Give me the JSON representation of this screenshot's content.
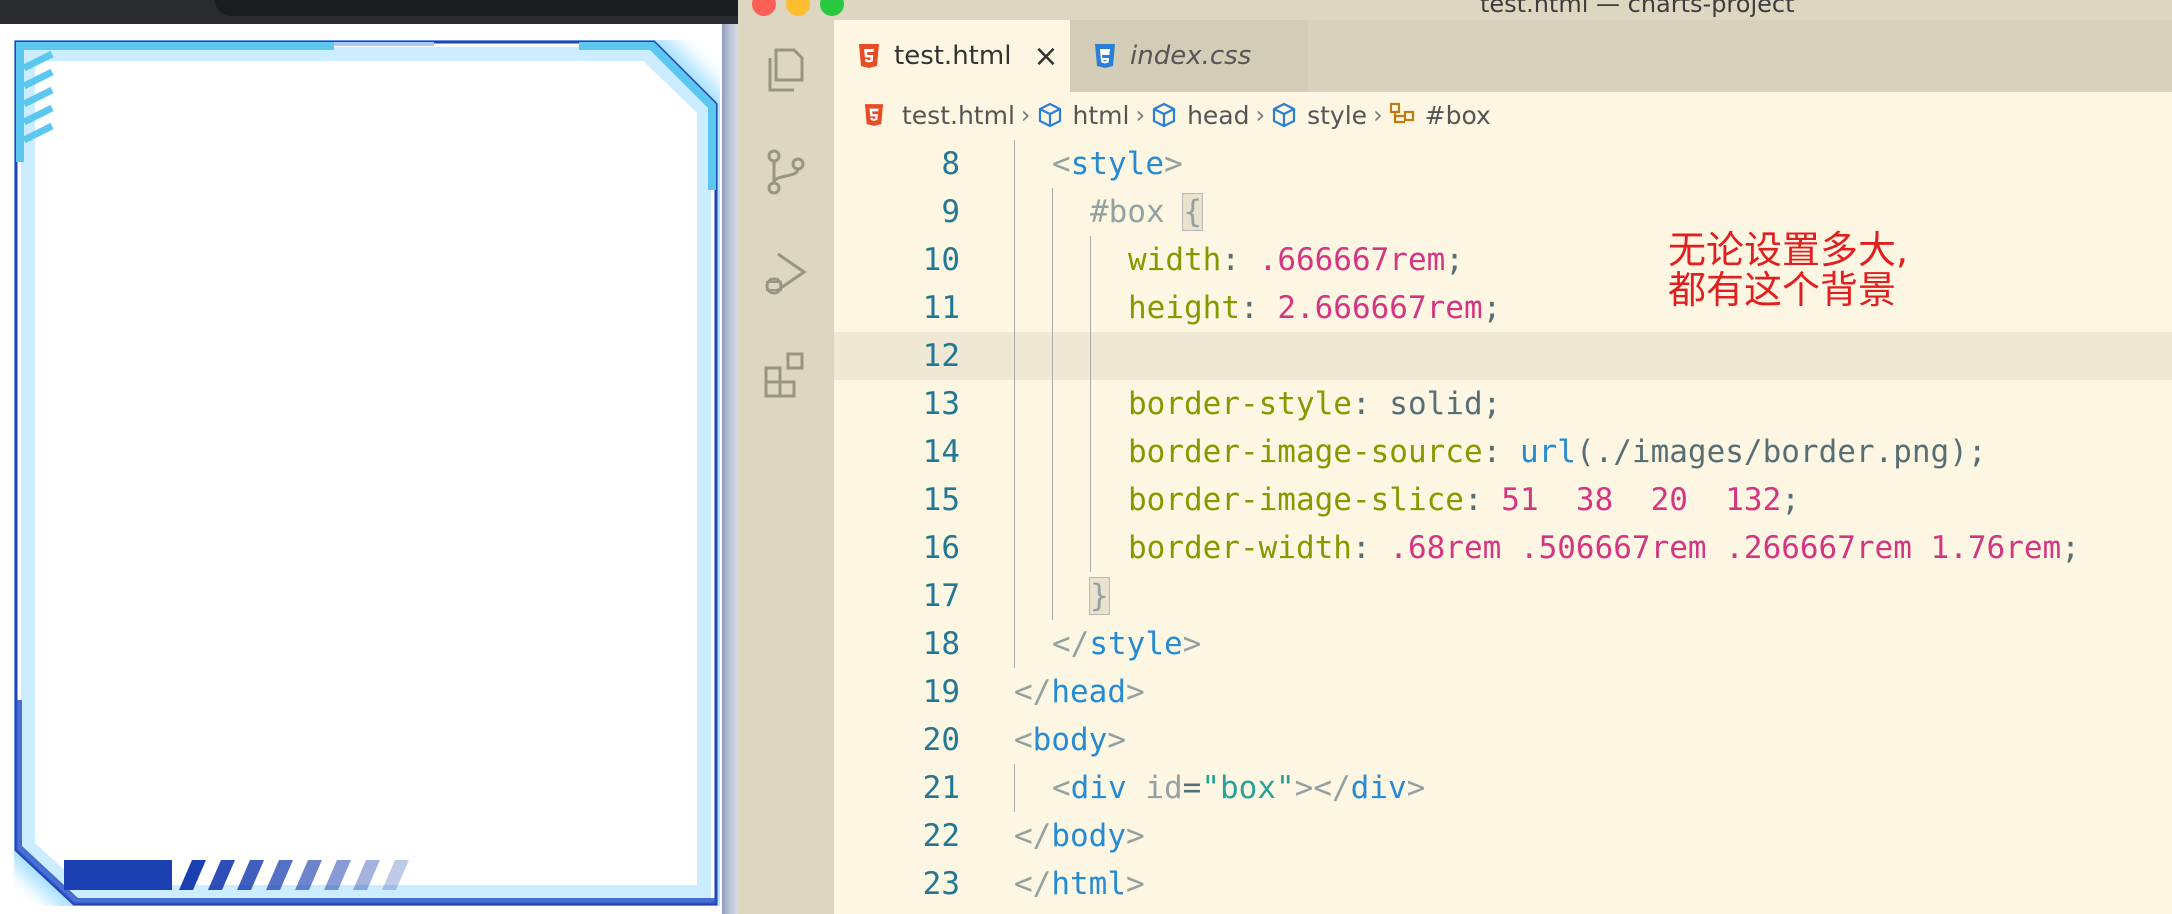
{
  "window": {
    "title": "test.html — charts-project"
  },
  "tabs": [
    {
      "label": "test.html",
      "icon": "html5-icon",
      "active": true,
      "close": "×"
    },
    {
      "label": "index.css",
      "icon": "css3-icon",
      "active": false
    }
  ],
  "breadcrumb": [
    {
      "label": "test.html",
      "icon": "html5-icon"
    },
    {
      "label": "html",
      "icon": "cube-icon"
    },
    {
      "label": "head",
      "icon": "cube-icon"
    },
    {
      "label": "style",
      "icon": "cube-icon"
    },
    {
      "label": "#box",
      "icon": "selector-icon"
    }
  ],
  "code": [
    {
      "n": "8",
      "tokens": [
        [
          "c-punct",
          "<"
        ],
        [
          "c-tag",
          "style"
        ],
        [
          "c-punct",
          ">"
        ]
      ],
      "indent": 1
    },
    {
      "n": "9",
      "tokens": [
        [
          "c-sel",
          "#box "
        ],
        [
          "c-punct brace-box",
          "{"
        ]
      ],
      "indent": 2
    },
    {
      "n": "10",
      "tokens": [
        [
          "c-prop",
          "width"
        ],
        [
          "c-plain",
          ": "
        ],
        [
          "c-num",
          ".666667rem"
        ],
        [
          "c-plain",
          ";"
        ]
      ],
      "indent": 3
    },
    {
      "n": "11",
      "tokens": [
        [
          "c-prop",
          "height"
        ],
        [
          "c-plain",
          ": "
        ],
        [
          "c-num",
          "2.666667rem"
        ],
        [
          "c-plain",
          ";"
        ]
      ],
      "indent": 3
    },
    {
      "n": "12",
      "tokens": [],
      "indent": 3,
      "current": true
    },
    {
      "n": "13",
      "tokens": [
        [
          "c-prop",
          "border-style"
        ],
        [
          "c-plain",
          ": "
        ],
        [
          "c-val",
          "solid"
        ],
        [
          "c-plain",
          ";"
        ]
      ],
      "indent": 3
    },
    {
      "n": "14",
      "tokens": [
        [
          "c-prop",
          "border-image-source"
        ],
        [
          "c-plain",
          ": "
        ],
        [
          "c-tag",
          "url"
        ],
        [
          "c-val",
          "(./images/border.png)"
        ],
        [
          "c-plain",
          ";"
        ]
      ],
      "indent": 3
    },
    {
      "n": "15",
      "tokens": [
        [
          "c-prop",
          "border-image-slice"
        ],
        [
          "c-plain",
          ": "
        ],
        [
          "c-num",
          "51  38  20  132"
        ],
        [
          "c-plain",
          ";"
        ]
      ],
      "indent": 3
    },
    {
      "n": "16",
      "tokens": [
        [
          "c-prop",
          "border-width"
        ],
        [
          "c-plain",
          ": "
        ],
        [
          "c-num",
          ".68rem .506667rem .266667rem 1.76rem"
        ],
        [
          "c-plain",
          ";"
        ]
      ],
      "indent": 3
    },
    {
      "n": "17",
      "tokens": [
        [
          "c-punct brace-box",
          "}"
        ]
      ],
      "indent": 2
    },
    {
      "n": "18",
      "tokens": [
        [
          "c-punct",
          "</"
        ],
        [
          "c-tag",
          "style"
        ],
        [
          "c-punct",
          ">"
        ]
      ],
      "indent": 1
    },
    {
      "n": "19",
      "tokens": [
        [
          "c-punct",
          "</"
        ],
        [
          "c-tag",
          "head"
        ],
        [
          "c-punct",
          ">"
        ]
      ],
      "indent": 0
    },
    {
      "n": "20",
      "tokens": [
        [
          "c-punct",
          "<"
        ],
        [
          "c-tag",
          "body"
        ],
        [
          "c-punct",
          ">"
        ]
      ],
      "indent": 0
    },
    {
      "n": "21",
      "tokens": [
        [
          "c-punct",
          "<"
        ],
        [
          "c-tag",
          "div "
        ],
        [
          "c-attr",
          "id"
        ],
        [
          "c-plain",
          "="
        ],
        [
          "c-str",
          "\"box\""
        ],
        [
          "c-punct",
          "></"
        ],
        [
          "c-tag",
          "div"
        ],
        [
          "c-punct",
          ">"
        ]
      ],
      "indent": 1
    },
    {
      "n": "22",
      "tokens": [
        [
          "c-punct",
          "</"
        ],
        [
          "c-tag",
          "body"
        ],
        [
          "c-punct",
          ">"
        ]
      ],
      "indent": 0
    },
    {
      "n": "23",
      "tokens": [
        [
          "c-punct",
          "</"
        ],
        [
          "c-tag",
          "html"
        ],
        [
          "c-punct",
          ">"
        ]
      ],
      "indent": 0
    }
  ],
  "annotation": {
    "line1": "无论设置多大,",
    "line2": "都有这个背景",
    "color": "#e02020"
  },
  "colors": {
    "accent_frame": "#1a3fb0",
    "frame_glow": "#7fd4ff"
  }
}
